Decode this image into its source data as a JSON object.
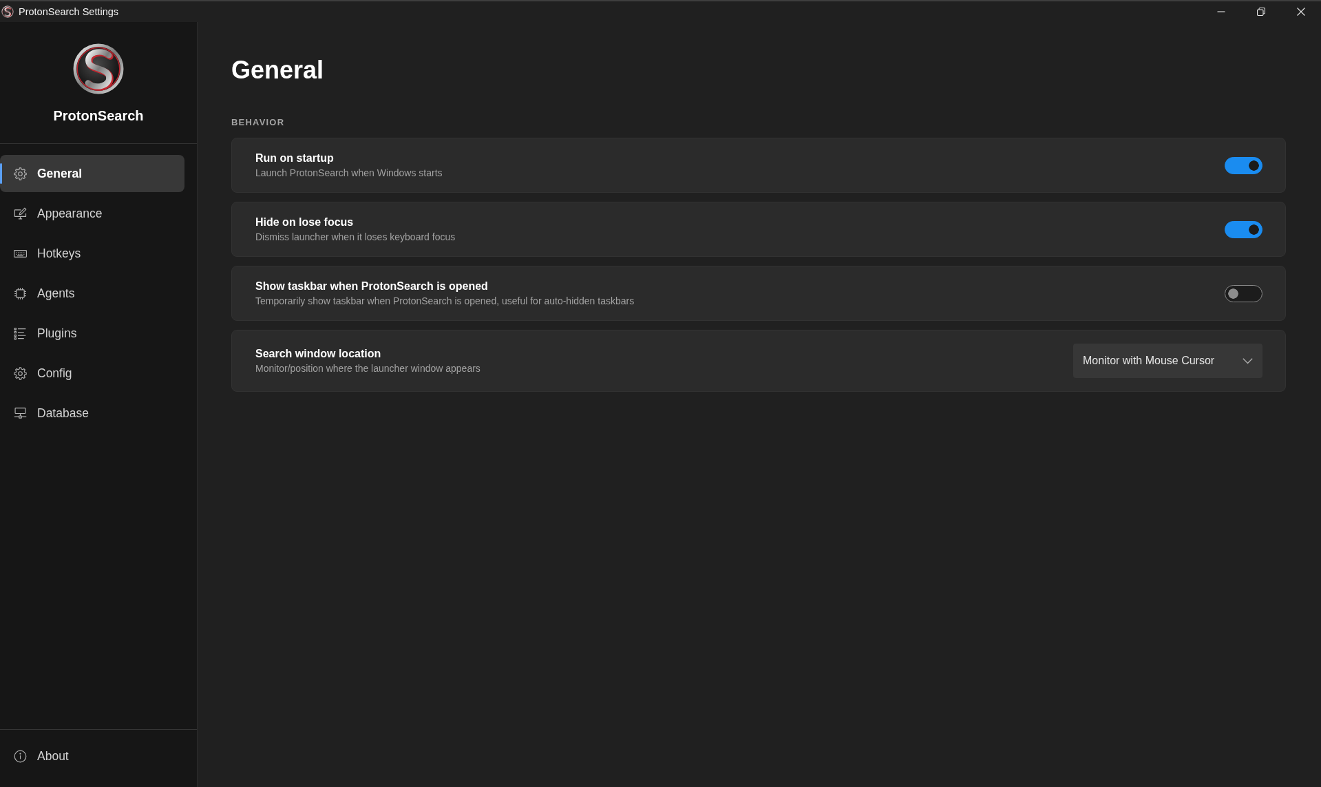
{
  "window": {
    "title": "ProtonSearch Settings"
  },
  "sidebar": {
    "app_name": "ProtonSearch",
    "items": [
      {
        "label": "General",
        "selected": true
      },
      {
        "label": "Appearance",
        "selected": false
      },
      {
        "label": "Hotkeys",
        "selected": false
      },
      {
        "label": "Agents",
        "selected": false
      },
      {
        "label": "Plugins",
        "selected": false
      },
      {
        "label": "Config",
        "selected": false
      },
      {
        "label": "Database",
        "selected": false
      }
    ],
    "footer_items": [
      {
        "label": "About",
        "selected": false
      }
    ]
  },
  "page": {
    "title": "General",
    "sections": [
      {
        "heading": "BEHAVIOR",
        "settings": [
          {
            "kind": "toggle",
            "title": "Run on startup",
            "description": "Launch ProtonSearch when Windows starts",
            "on": true
          },
          {
            "kind": "toggle",
            "title": "Hide on lose focus",
            "description": "Dismiss launcher when it loses keyboard focus",
            "on": true
          },
          {
            "kind": "toggle",
            "title": "Show taskbar when ProtonSearch is opened",
            "description": "Temporarily show taskbar when ProtonSearch is opened, useful for auto-hidden taskbars",
            "on": false
          },
          {
            "kind": "dropdown",
            "title": "Search window location",
            "description": "Monitor/position where the launcher window appears",
            "value": "Monitor with Mouse Cursor"
          }
        ]
      }
    ]
  }
}
